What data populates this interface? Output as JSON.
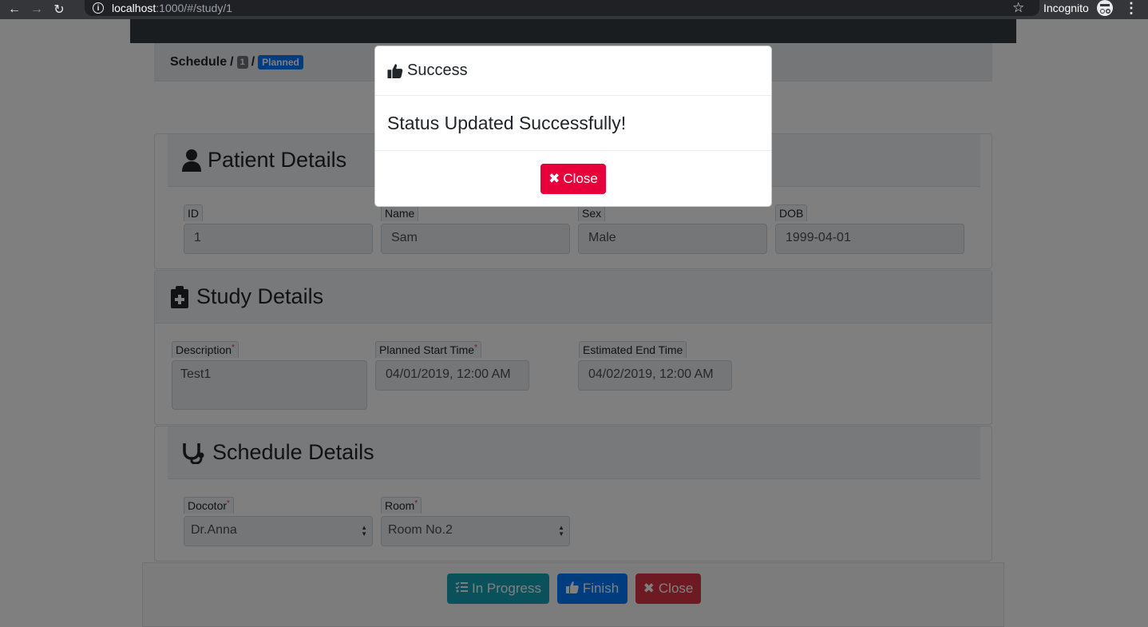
{
  "browser": {
    "url_host": "localhost",
    "url_path": ":1000/#/study/1",
    "incognito_label": "Incognito"
  },
  "breadcrumb": {
    "root": "Schedule",
    "separator": "/",
    "study_id": "1",
    "status": "Planned"
  },
  "patient": {
    "title": "Patient Details",
    "fields": [
      {
        "label": "ID",
        "value": "1"
      },
      {
        "label": "Name",
        "value": "Sam"
      },
      {
        "label": "Sex",
        "value": "Male"
      },
      {
        "label": "DOB",
        "value": "1999-04-01"
      }
    ]
  },
  "study": {
    "title": "Study Details",
    "description_label": "Description",
    "description_value": "Test1",
    "start_label": "Planned Start Time",
    "start_value": "04/01/2019, 12:00 AM",
    "end_label": "Estimated End Time",
    "end_value": "04/02/2019, 12:00 AM",
    "required_mark": "*"
  },
  "schedule": {
    "title": "Schedule Details",
    "doctor_label": "Docotor",
    "doctor_value": "Dr.Anna",
    "room_label": "Room",
    "room_value": "Room No.2"
  },
  "actions": {
    "in_progress": "In Progress",
    "finish": "Finish",
    "close": "Close"
  },
  "modal": {
    "title": "Success",
    "message": "Status Updated Successfully!",
    "close": "Close"
  },
  "colors": {
    "in_progress": "#17a2b8",
    "finish": "#007bff",
    "close": "#dc3545",
    "modal_close": "#e8003a"
  }
}
